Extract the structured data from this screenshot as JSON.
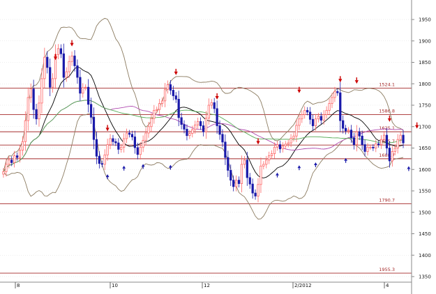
{
  "chart_data": {
    "type": "candlestick",
    "ylim": [
      1335,
      1975
    ],
    "y_ticks": [
      1350,
      1400,
      1450,
      1500,
      1550,
      1600,
      1650,
      1700,
      1750,
      1800,
      1850,
      1900,
      1950
    ],
    "y_tick_labels": [
      "1350",
      "1400",
      "1450",
      "1500",
      "1550",
      "1600",
      "1650",
      "1700",
      "1750",
      "1800",
      "1850",
      "1900",
      "1950"
    ],
    "x_labels": [
      "8",
      "10",
      "12",
      "2/2012",
      "4"
    ],
    "horizontal_lines": [
      {
        "y": 1790,
        "label": "1524.1"
      },
      {
        "y": 1728,
        "label": "1586.8"
      },
      {
        "y": 1688,
        "label": "1625.1"
      },
      {
        "y": 1657,
        "label": "1655.7"
      },
      {
        "y": 1625,
        "label": "1688.7"
      },
      {
        "y": 1520,
        "label": "1790.7"
      },
      {
        "y": 1358,
        "label": "1955.3"
      }
    ],
    "grid": true,
    "colors": {
      "down_candle": "#1a1aaa",
      "up_candle": "#ff6666",
      "bollinger": "#8b7b60",
      "ma_fast": "#000000",
      "ma_mid": "#b04ab0",
      "ma_slow": "#55aa55",
      "sr_line": "#a52a2a",
      "arrow_down": "#cc0000",
      "arrow_up": "#1a1aaa",
      "grid": "#dddddd"
    },
    "closes": [
      1595,
      1612,
      1622,
      1616,
      1632,
      1628,
      1645,
      1665,
      1714,
      1768,
      1788,
      1740,
      1718,
      1755,
      1812,
      1862,
      1838,
      1792,
      1812,
      1868,
      1882,
      1870,
      1815,
      1828,
      1852,
      1865,
      1842,
      1815,
      1778,
      1791,
      1792,
      1752,
      1722,
      1670,
      1631,
      1614,
      1612,
      1634,
      1658,
      1672,
      1665,
      1662,
      1647,
      1652,
      1672,
      1685,
      1682,
      1676,
      1651,
      1635,
      1652,
      1668,
      1685,
      1700,
      1719,
      1738,
      1740,
      1754,
      1760,
      1787,
      1798,
      1785,
      1772,
      1764,
      1721,
      1705,
      1694,
      1679,
      1684,
      1693,
      1704,
      1712,
      1702,
      1688,
      1720,
      1750,
      1756,
      1742,
      1702,
      1682,
      1664,
      1628,
      1598,
      1575,
      1560,
      1575,
      1567,
      1612,
      1622,
      1581,
      1566,
      1545,
      1538,
      1565,
      1608,
      1612,
      1622,
      1632,
      1637,
      1652,
      1658,
      1648,
      1655,
      1659,
      1662,
      1673,
      1678,
      1703,
      1718,
      1728,
      1738,
      1734,
      1717,
      1702,
      1718,
      1724,
      1715,
      1728,
      1738,
      1754,
      1768,
      1782,
      1779,
      1714,
      1696,
      1690,
      1692,
      1674,
      1658,
      1688,
      1678,
      1658,
      1642,
      1652,
      1652,
      1650,
      1660,
      1658,
      1670,
      1680,
      1650,
      1620,
      1642,
      1650,
      1670,
      1680,
      1662
    ],
    "arrows_down": [
      [
        19,
        1852
      ],
      [
        25,
        1884
      ],
      [
        63,
        1817
      ],
      [
        78,
        1760
      ],
      [
        108,
        1775
      ],
      [
        123,
        1800
      ],
      [
        129,
        1797
      ],
      [
        141,
        1708
      ],
      [
        151,
        1692
      ],
      [
        38,
        1686
      ],
      [
        93,
        1655
      ]
    ],
    "arrows_up": [
      [
        38,
        1592
      ],
      [
        44,
        1612
      ],
      [
        61,
        1614
      ],
      [
        100,
        1596
      ],
      [
        125,
        1630
      ],
      [
        148,
        1611
      ],
      [
        51,
        1616
      ],
      [
        108,
        1613
      ],
      [
        114,
        1620
      ]
    ]
  }
}
